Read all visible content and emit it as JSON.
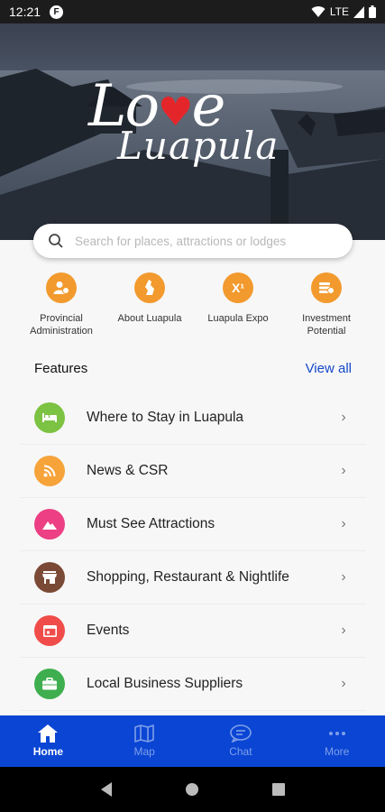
{
  "status_bar": {
    "time": "12:21",
    "app_indicator": "F",
    "network": "LTE"
  },
  "brand": {
    "line1_a": "Lo",
    "line1_b": "e",
    "line2": "Luapula"
  },
  "search": {
    "placeholder": "Search for places, attractions or lodges"
  },
  "quick_links": [
    {
      "label": "Provincial Administration",
      "icon": "person-badge-icon"
    },
    {
      "label": "About Luapula",
      "icon": "province-map-icon"
    },
    {
      "label": "Luapula Expo",
      "icon": "expo-x1-icon",
      "glyph": "X¹"
    },
    {
      "label": "Investment Potential",
      "icon": "coins-icon"
    }
  ],
  "features": {
    "title": "Features",
    "view_all": "View all",
    "items": [
      {
        "label": "Where to Stay in Luapula",
        "color": "#7cc243",
        "icon": "bed-icon"
      },
      {
        "label": "News & CSR",
        "color": "#f6a33a",
        "icon": "rss-icon"
      },
      {
        "label": "Must See Attractions",
        "color": "#ec3f84",
        "icon": "mountain-icon"
      },
      {
        "label": "Shopping, Restaurant & Nightlife",
        "color": "#7a4a36",
        "icon": "store-icon"
      },
      {
        "label": "Events",
        "color": "#f04d4a",
        "icon": "calendar-icon"
      },
      {
        "label": "Local Business Suppliers",
        "color": "#3fae4e",
        "icon": "briefcase-icon"
      }
    ]
  },
  "tabs": [
    {
      "label": "Home",
      "icon": "home-icon",
      "active": true
    },
    {
      "label": "Map",
      "icon": "map-icon",
      "active": false
    },
    {
      "label": "Chat",
      "icon": "chat-icon",
      "active": false
    },
    {
      "label": "More",
      "icon": "more-dots-icon",
      "active": false
    }
  ],
  "colors": {
    "accent": "#0a45d4",
    "quick_icon": "#f29a2e",
    "view_all": "#1648c9"
  }
}
